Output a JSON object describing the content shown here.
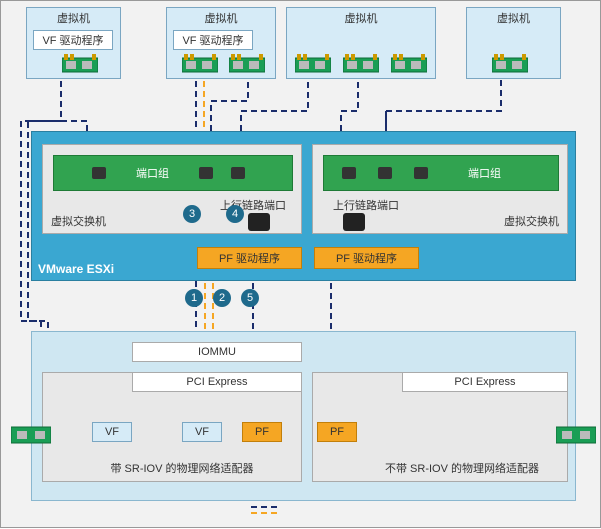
{
  "vm_label": "虚拟机",
  "vf_driver_label": "VF 驱动程序",
  "esxi_label": "VMware ESXi",
  "vswitch_label": "虚拟交换机",
  "portgroup_label": "端口组",
  "uplink_label": "上行链路端口",
  "pf_driver_label": "PF 驱动程序",
  "iommu_label": "IOMMU",
  "pcie_label": "PCI Express",
  "vf_label": "VF",
  "pf_label": "PF",
  "adapter_with_sriov": "带 SR-IOV 的物理网络适配器",
  "adapter_without_sriov": "不带 SR-IOV 的物理网络适配器",
  "steps": {
    "s1": "1",
    "s2": "2",
    "s3": "3",
    "s4": "4",
    "s5": "5"
  },
  "legend": {
    "data_path": "",
    "control_path": ""
  }
}
